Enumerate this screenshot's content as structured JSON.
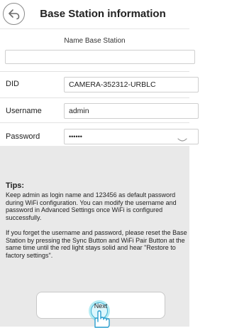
{
  "header": {
    "title": "Base Station information",
    "back_icon": "back-arrow-icon"
  },
  "form": {
    "name_label": "Name Base Station",
    "name_value": "",
    "rows": [
      {
        "label": "DID",
        "value": "CAMERA-352312-URBLC"
      },
      {
        "label": "Username",
        "value": "admin"
      },
      {
        "label": "Password",
        "value": "••••••"
      }
    ],
    "password_toggle_icon": "eye-toggle-icon"
  },
  "tips": {
    "title": "Tips:",
    "paragraphs": [
      "Keep admin as login name and 123456 as default password during WiFi configuration. You can modify the username and password in Advanced Settings once WiFi is configured successfully.",
      "If you forget the username and password, please reset the Base Station by pressing the Sync Button and WiFi Pair Button at the same time until the red light stays solid and hear \"Restore to factory settings\"."
    ]
  },
  "next_button": {
    "label": "Next",
    "hint_icon": "tap-hand-icon"
  },
  "colors": {
    "background": "#ffffff",
    "tips_background": "#e9e9e9",
    "highlight_ring": "#3fb0d3"
  }
}
